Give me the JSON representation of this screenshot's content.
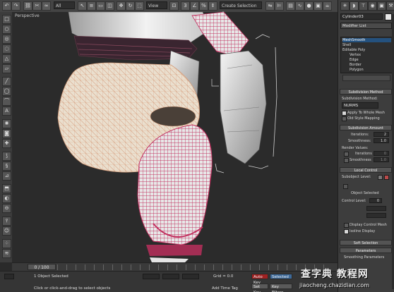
{
  "toolbar": {
    "selection_filter": "All",
    "reference_coord": "View",
    "named_selection": "Create Selection Se",
    "icons": [
      "undo-icon",
      "redo-icon",
      "select-link-icon",
      "unlink-icon",
      "bind-spacewarp-icon",
      "selection-filter",
      "select-object-icon",
      "select-by-name-icon",
      "rect-select-icon",
      "window-crossing-icon",
      "move-icon",
      "rotate-icon",
      "scale-icon",
      "reference-coord",
      "pivot-icon",
      "snap-icon",
      "angle-snap-icon",
      "percent-snap-icon",
      "spinner-snap-icon",
      "named-selection",
      "mirror-icon",
      "align-icon"
    ]
  },
  "viewport": {
    "label": "Perspective"
  },
  "command_panel": {
    "object_name": "Cylinder03",
    "modifier_list": "Modifier List",
    "stack": [
      "MeshSmooth",
      "Shell",
      "Editable Poly",
      "Vertex",
      "Edge",
      "Border",
      "Polygon"
    ],
    "subdivision_method": {
      "header": "Subdivision Method",
      "label": "Subdivision Method:",
      "value": "NURMS",
      "apply_whole_mesh": "Apply To Whole Mesh",
      "old_style_mapping": "Old Style Mapping"
    },
    "subdivision_amount": {
      "header": "Subdivision Amount",
      "iterations_label": "Iterations:",
      "iterations_value": "2",
      "smoothness_label": "Smoothness:",
      "smoothness_value": "1.0",
      "render_values": "Render Values:",
      "render_iterations_label": "Iterations",
      "render_iterations_value": "0",
      "render_smoothness_label": "Smoothness",
      "render_smoothness_value": "1.0"
    },
    "local_control": {
      "header": "Local Control",
      "subobject_level": "Subobject Level:",
      "object_selected": "Object Selected",
      "control_level": "Control Level:",
      "control_level_value": "0",
      "display_control_mesh": "Display Control Mesh",
      "isoline_display": "Isoline Display"
    },
    "soft_selection": {
      "header": "Soft Selection"
    },
    "parameters": {
      "header": "Parameters",
      "smoothing": "Smoothing Parameters"
    }
  },
  "timeline": {
    "frame": "0 / 100"
  },
  "status": {
    "selected": "1 Object Selected",
    "prompt": "Click or click-and-drag to select objects",
    "grid": "Grid = 0.0",
    "auto_key": "Auto Key",
    "selected_btn": "Selected",
    "set_key": "Set Key",
    "key_filters": "Key Filters...",
    "add_time_tag": "Add Time Tag"
  },
  "watermark": {
    "cn": "查字典 教程网",
    "url": "jiaocheng.chazidian.com"
  },
  "colors": {
    "wire_pink": "#c2305f",
    "wire_cream": "#e9c8a8",
    "shell_white": "#e4e4e4",
    "bg": "#2b2b2b",
    "accent_blue": "#24517e"
  }
}
